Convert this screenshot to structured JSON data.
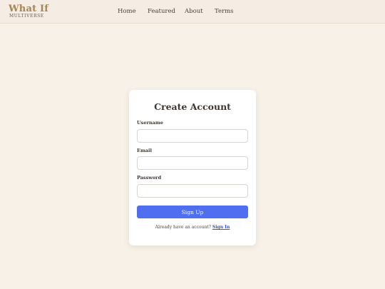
{
  "header": {
    "logo_title": "What If",
    "logo_subtitle": "MULTIVERSE",
    "nav": [
      "Home",
      "Featured",
      "About",
      "Terms"
    ]
  },
  "signup_form": {
    "title": "Create Account",
    "username_label": "Username",
    "username_value": "",
    "email_label": "Email",
    "email_value": "",
    "password_label": "Password",
    "password_value": "",
    "submit_label": "Sign Up",
    "footer_prompt": "Already have an account?",
    "signin_label": "Sign In"
  },
  "colors": {
    "background": "#f7f1e8",
    "header_background": "#f5ede3",
    "brand": "#a68555",
    "accent": "#4f6ef0",
    "link": "#2e52d9"
  }
}
